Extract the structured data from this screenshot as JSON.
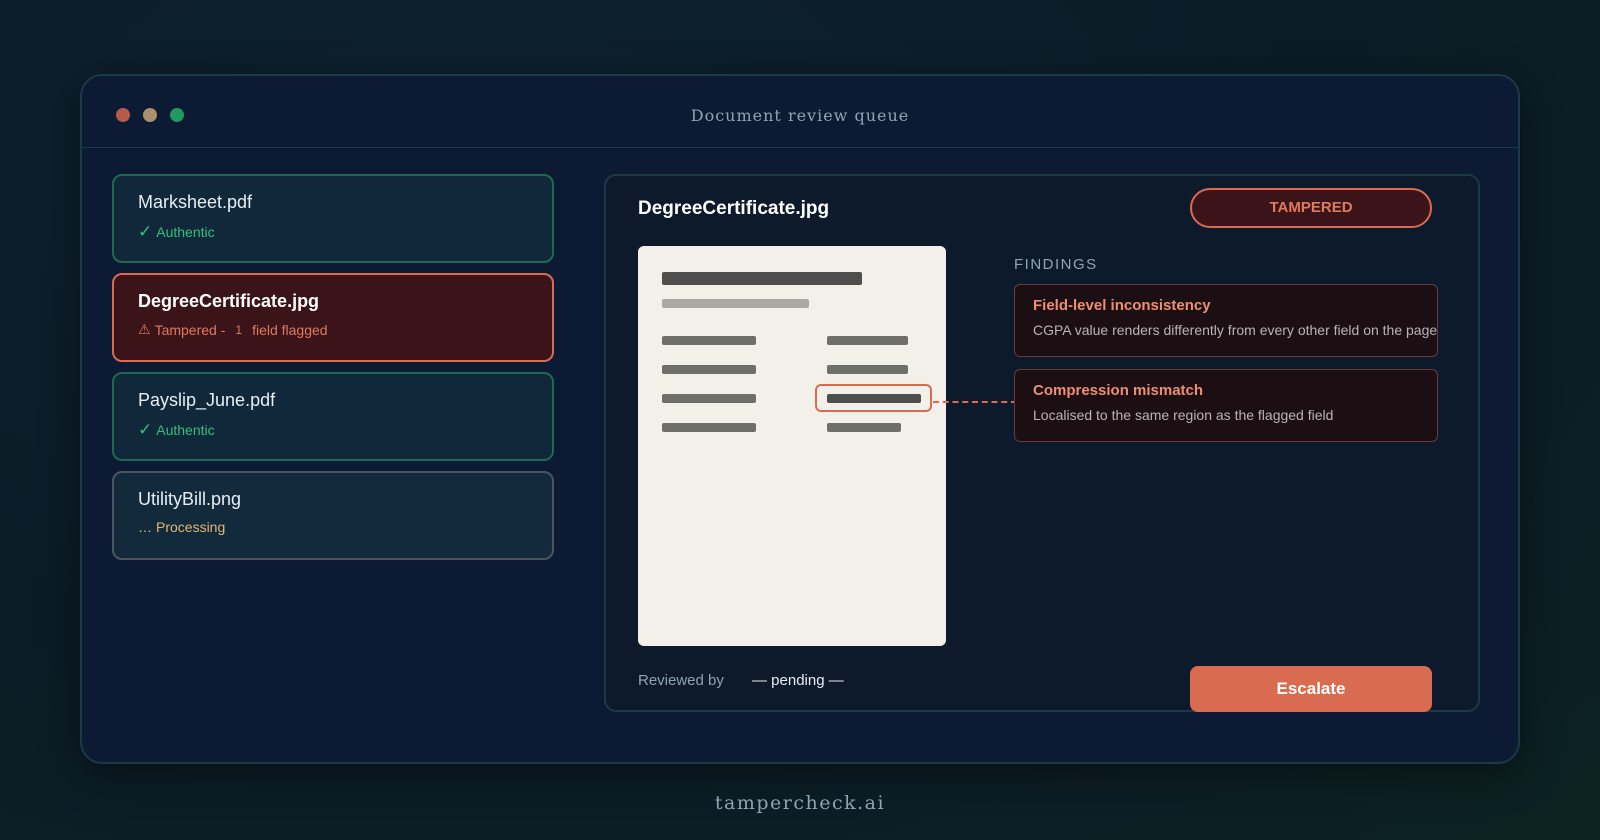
{
  "window": {
    "title": "Document review queue"
  },
  "queue": {
    "items": [
      {
        "name": "Marksheet.pdf",
        "status_icon": "✓",
        "status_text": "Authentic"
      },
      {
        "name": "DegreeCertificate.jpg",
        "status_icon": "⚠",
        "status_text": "Tampered -",
        "flag_count": "1",
        "flag_suffix": "field flagged"
      },
      {
        "name": "Payslip_June.pdf",
        "status_icon": "✓",
        "status_text": "Authentic"
      },
      {
        "name": "UtilityBill.png",
        "status_icon": "…",
        "status_text": "Processing"
      }
    ]
  },
  "detail": {
    "title": "DegreeCertificate.jpg",
    "verdict": "TAMPERED",
    "findings_label": "FINDINGS",
    "findings": [
      {
        "title": "Field-level inconsistency",
        "description": "CGPA value renders differently from every other field on the page"
      },
      {
        "title": "Compression mismatch",
        "description": "Localised to the same region as the flagged field"
      }
    ],
    "reviewed_by_label": "Reviewed by",
    "reviewer": "— pending —",
    "escalate_label": "Escalate"
  },
  "footer": {
    "brand": "tampercheck.ai"
  },
  "colors": {
    "authentic": "#2fc07a",
    "tampered": "#d96c50",
    "processing": "#e0b870",
    "window_bg": "#0c1b33"
  },
  "icons": {
    "authentic": "check-icon",
    "tampered": "warning-icon",
    "processing": "ellipsis-icon"
  }
}
